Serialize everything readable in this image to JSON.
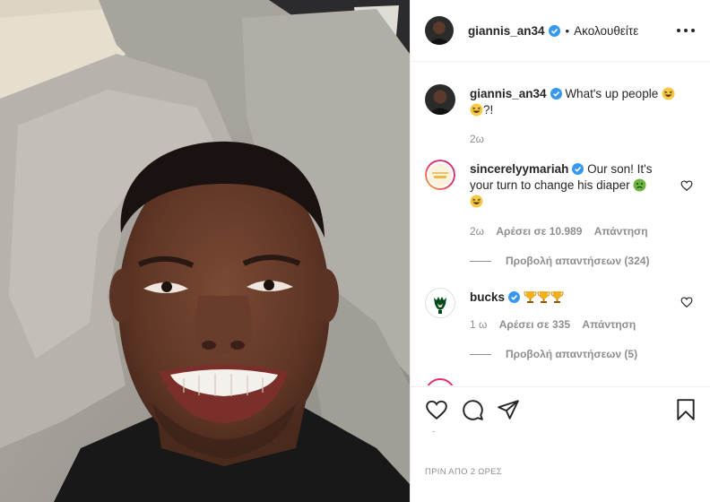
{
  "colors": {
    "text": "#262626",
    "secondary": "#8e8e8e",
    "verified": "#3897f0",
    "border": "#efefef"
  },
  "header": {
    "username": "giannis_an34",
    "separator": "•",
    "follow_status": "Ακολουθείτε",
    "more_icon": "more-options-icon"
  },
  "caption": {
    "username": "giannis_an34",
    "text": "What's up people",
    "text_suffix": "?!",
    "emoji_1": "grinning-squinting-face",
    "emoji_2": "grinning-squinting-face",
    "time": "2ω"
  },
  "comments": [
    {
      "username": "sincerelyymariah",
      "text": "Our son! It's your turn to change his diaper",
      "emoji_1": "nauseated-face",
      "emoji_2": "grinning-squinting-face",
      "time": "2ω",
      "likes": "Αρέσει σε 10.989",
      "reply": "Απάντηση",
      "view_replies": "Προβολή απαντήσεων (324)"
    },
    {
      "username": "bucks",
      "text": "",
      "emoji": [
        "trophy",
        "trophy",
        "trophy"
      ],
      "time": "1 ω",
      "likes": "Αρέσει σε 335",
      "reply": "Απάντηση",
      "view_replies": "Προβολή απαντήσεων (5)"
    }
  ],
  "actions": {
    "like_icon": "heart-icon",
    "comment_icon": "comment-icon",
    "share_icon": "share-icon",
    "save_icon": "bookmark-icon"
  },
  "timestamp": "ΠΡΙΝ ΑΠΟ 2 ΩΡΕΣ"
}
